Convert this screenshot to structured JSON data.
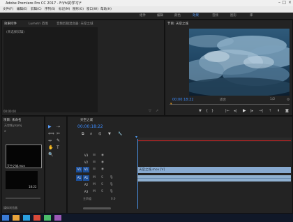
{
  "window": {
    "title": "Adobe Premiere Pro CC 2017 - F:\\fh\\的学习\\*"
  },
  "menu": [
    "文件(F)",
    "编辑(E)",
    "剪辑(C)",
    "序列(S)",
    "标记(M)",
    "图形(G)",
    "窗口(W)",
    "帮助(H)"
  ],
  "workspaces": [
    "组件",
    "编辑",
    "颜色",
    "效果",
    "音频",
    "图形",
    "库"
  ],
  "effects_panel": {
    "tabs": [
      "效果控件",
      "Lumetri 范围",
      "音频剪辑混合器: 天空之城"
    ],
    "empty_text": "(未选择剪辑)",
    "time": "00:00:00"
  },
  "program_monitor": {
    "title": "节目: 天空之城",
    "timecode": "00:00:18:22",
    "fit": "适合",
    "quality": "1/2",
    "duration": "00:00:30:08"
  },
  "project_panel": {
    "title": "项目: 未命名",
    "file": "天空城.prproj",
    "clip_label": "天空之城.mov",
    "clip_duration": "18:22",
    "footer": "媒体浏览器"
  },
  "timeline": {
    "sequence_name": "天空之城",
    "timecode": "00:00:18:22",
    "tracks": {
      "video": [
        "V3",
        "V2",
        "V1"
      ],
      "audio": [
        "A1",
        "A2",
        "A3"
      ],
      "master": "主声道",
      "master_value": "0.0"
    },
    "source_patch": {
      "video": "V1",
      "audio": "A1"
    },
    "clip_name": "天空之城.mov [V]"
  },
  "colors": {
    "accent": "#3c8cff",
    "clip": "#87a9cf",
    "playhead": "#4a90e2",
    "bar": "#b32424"
  }
}
